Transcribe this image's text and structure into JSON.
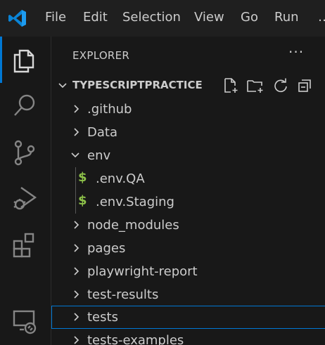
{
  "menu": {
    "items": [
      "File",
      "Edit",
      "Selection",
      "View",
      "Go",
      "Run"
    ],
    "overflow": "…"
  },
  "activity_bar": {
    "items": [
      "explorer-icon",
      "search-icon",
      "source-control-icon",
      "run-debug-icon",
      "extensions-icon",
      "remote-explorer-icon"
    ],
    "active": "explorer-icon",
    "accent": "#0078d4"
  },
  "sidebar": {
    "title": "EXPLORER",
    "more": "···",
    "section": {
      "title": "TYPESCRIPTPRACTICE",
      "actions": [
        "new-file-icon",
        "new-folder-icon",
        "refresh-icon",
        "collapse-all-icon"
      ]
    },
    "tree": [
      {
        "label": ".github",
        "type": "folder",
        "expanded": false
      },
      {
        "label": "Data",
        "type": "folder",
        "expanded": false
      },
      {
        "label": "env",
        "type": "folder",
        "expanded": true
      },
      {
        "label": ".env.QA",
        "type": "file",
        "icon": "$"
      },
      {
        "label": ".env.Staging",
        "type": "file",
        "icon": "$"
      },
      {
        "label": "node_modules",
        "type": "folder",
        "expanded": false
      },
      {
        "label": "pages",
        "type": "folder",
        "expanded": false
      },
      {
        "label": "playwright-report",
        "type": "folder",
        "expanded": false
      },
      {
        "label": "test-results",
        "type": "folder",
        "expanded": false
      },
      {
        "label": "tests",
        "type": "folder",
        "expanded": false,
        "selected": true
      },
      {
        "label": "tests-examples",
        "type": "folder",
        "expanded": false
      }
    ],
    "file_icon_color": "#8dc149"
  }
}
